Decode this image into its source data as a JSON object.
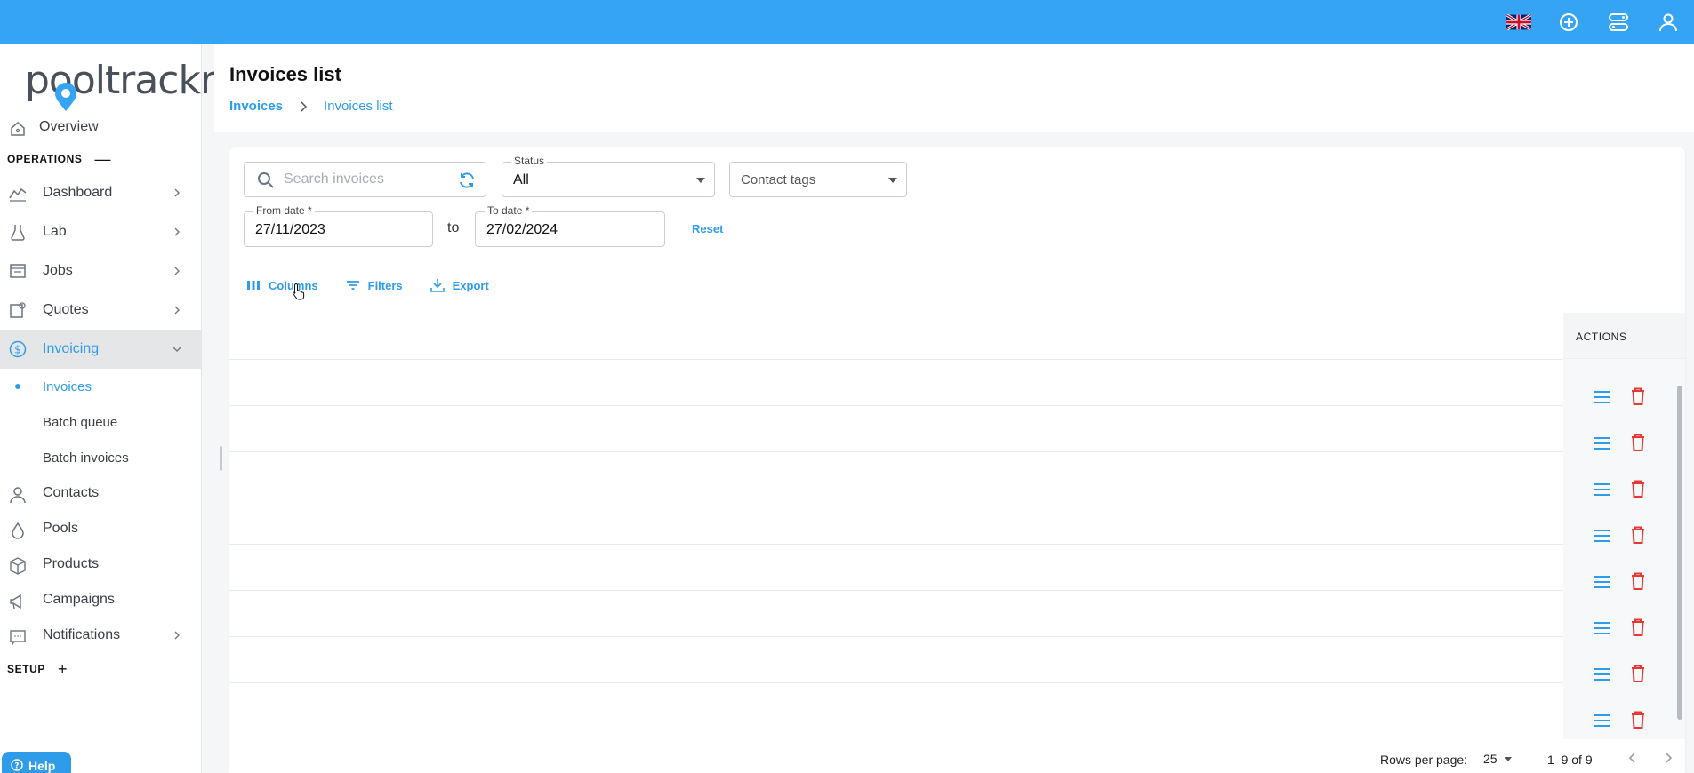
{
  "app": {
    "logo_text": "pooltrackr"
  },
  "topbar": {
    "icons": [
      "uk-flag-icon",
      "add-circle-icon",
      "switch-account-icon",
      "user-icon"
    ],
    "accent_color": "#35a4f4"
  },
  "sidebar": {
    "overview": "Overview",
    "operations_label": "OPERATIONS",
    "operations_sign": "—",
    "items": {
      "dashboard": "Dashboard",
      "lab": "Lab",
      "jobs": "Jobs",
      "quotes": "Quotes",
      "invoicing": "Invoicing"
    },
    "invoicing_sub": {
      "invoices": "Invoices",
      "batch_queue": "Batch queue",
      "batch_invoices": "Batch invoices"
    },
    "more": {
      "contacts": "Contacts",
      "pools": "Pools",
      "products": "Products",
      "campaigns": "Campaigns",
      "notifications": "Notifications"
    },
    "setup_label": "SETUP",
    "setup_sign": "+",
    "help_label": "Help"
  },
  "header": {
    "title": "Invoices list",
    "breadcrumb": {
      "root": "Invoices",
      "current": "Invoices list"
    }
  },
  "filters": {
    "search_placeholder": "Search invoices",
    "status_label": "Status",
    "status_value": "All",
    "contact_tags_placeholder": "Contact tags",
    "from_label": "From date *",
    "from_value": "27/11/2023",
    "to_text": "to",
    "to_label": "To date *",
    "to_value": "27/02/2024",
    "reset_label": "Reset"
  },
  "toolbar": {
    "columns": "Columns",
    "filters": "Filters",
    "export": "Export"
  },
  "grid": {
    "actions_header": "ACTIONS",
    "visible_action_rows": 9,
    "action_icon_color": "#2f9cea",
    "delete_icon_color": "#e53935"
  },
  "pagination": {
    "rows_per_page_label": "Rows per page:",
    "rows_per_page_value": "25",
    "range": "1–9 of 9"
  }
}
